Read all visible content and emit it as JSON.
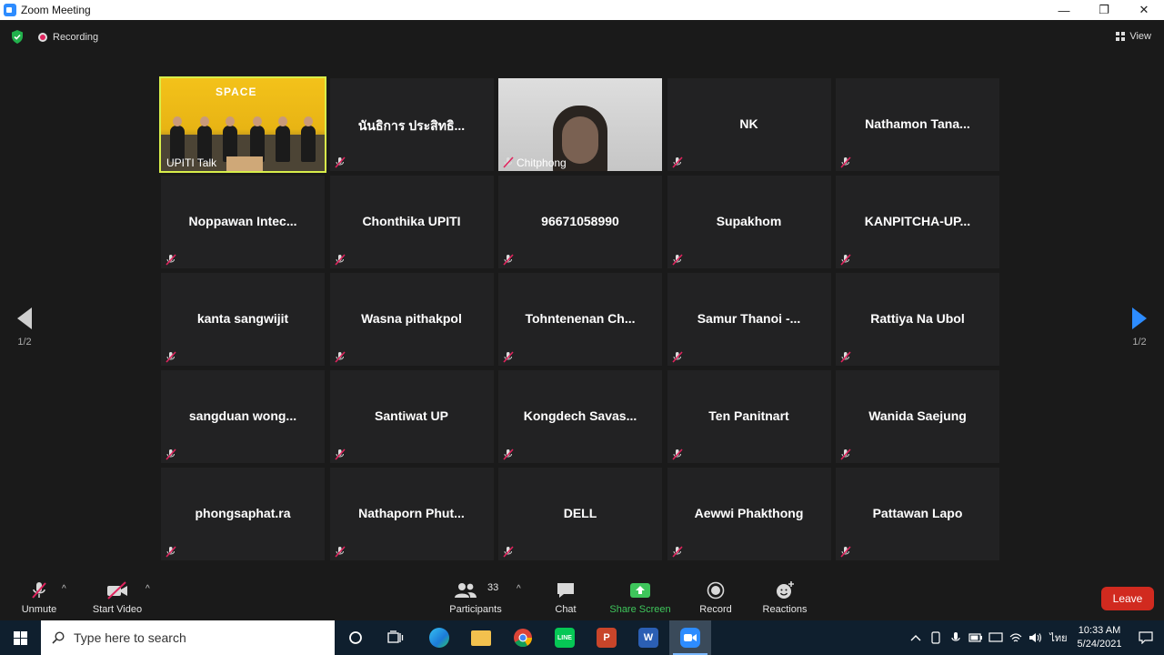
{
  "window": {
    "title": "Zoom Meeting",
    "min": "—",
    "restore": "❐",
    "close": "✕"
  },
  "topbar": {
    "recording_label": "Recording",
    "view_label": "View"
  },
  "colors": {
    "active_speaker_border": "#d8ee4a",
    "leave_red": "#d12a1f",
    "share_green": "#3ec55b",
    "nav_blue": "#2d8cff"
  },
  "pagination": {
    "left_page": "1/2",
    "right_page": "1/2"
  },
  "tiles": [
    {
      "name": "UPITI Talk",
      "video": "event"
    },
    {
      "name": "นันธิการ ประสิทธิ..."
    },
    {
      "name": "Chitphong",
      "video": "camera"
    },
    {
      "name": "NK"
    },
    {
      "name": "Nathamon  Tana..."
    },
    {
      "name": "Noppawan  Intec..."
    },
    {
      "name": "Chonthika UPITI"
    },
    {
      "name": "96671058990"
    },
    {
      "name": "Supakhom"
    },
    {
      "name": "KANPITCHA-UP..."
    },
    {
      "name": "kanta sangwijit"
    },
    {
      "name": "Wasna pithakpol"
    },
    {
      "name": "Tohntenenan  Ch..."
    },
    {
      "name": "Samur  Thanoi  -..."
    },
    {
      "name": "Rattiya Na Ubol"
    },
    {
      "name": "sangduan  wong..."
    },
    {
      "name": "Santiwat UP"
    },
    {
      "name": "Kongdech  Savas..."
    },
    {
      "name": "Ten Panitnart"
    },
    {
      "name": "Wanida Saejung"
    },
    {
      "name": "phongsaphat.ra"
    },
    {
      "name": "Nathaporn  Phut..."
    },
    {
      "name": "DELL"
    },
    {
      "name": "Aewwi Phakthong"
    },
    {
      "name": "Pattawan Lapo"
    }
  ],
  "event_sign": "SPACE",
  "toolbar": {
    "unmute": "Unmute",
    "start_video": "Start Video",
    "participants": "Participants",
    "participant_count": "33",
    "chat": "Chat",
    "share_screen": "Share Screen",
    "record": "Record",
    "reactions": "Reactions",
    "leave": "Leave"
  },
  "taskbar": {
    "search_placeholder": "Type here to search",
    "time": "10:33 AM",
    "date": "5/24/2021",
    "language": "ไทย",
    "apps": [
      "task-view",
      "edge",
      "file-explorer",
      "chrome",
      "line",
      "powerpoint",
      "word",
      "zoom"
    ]
  }
}
